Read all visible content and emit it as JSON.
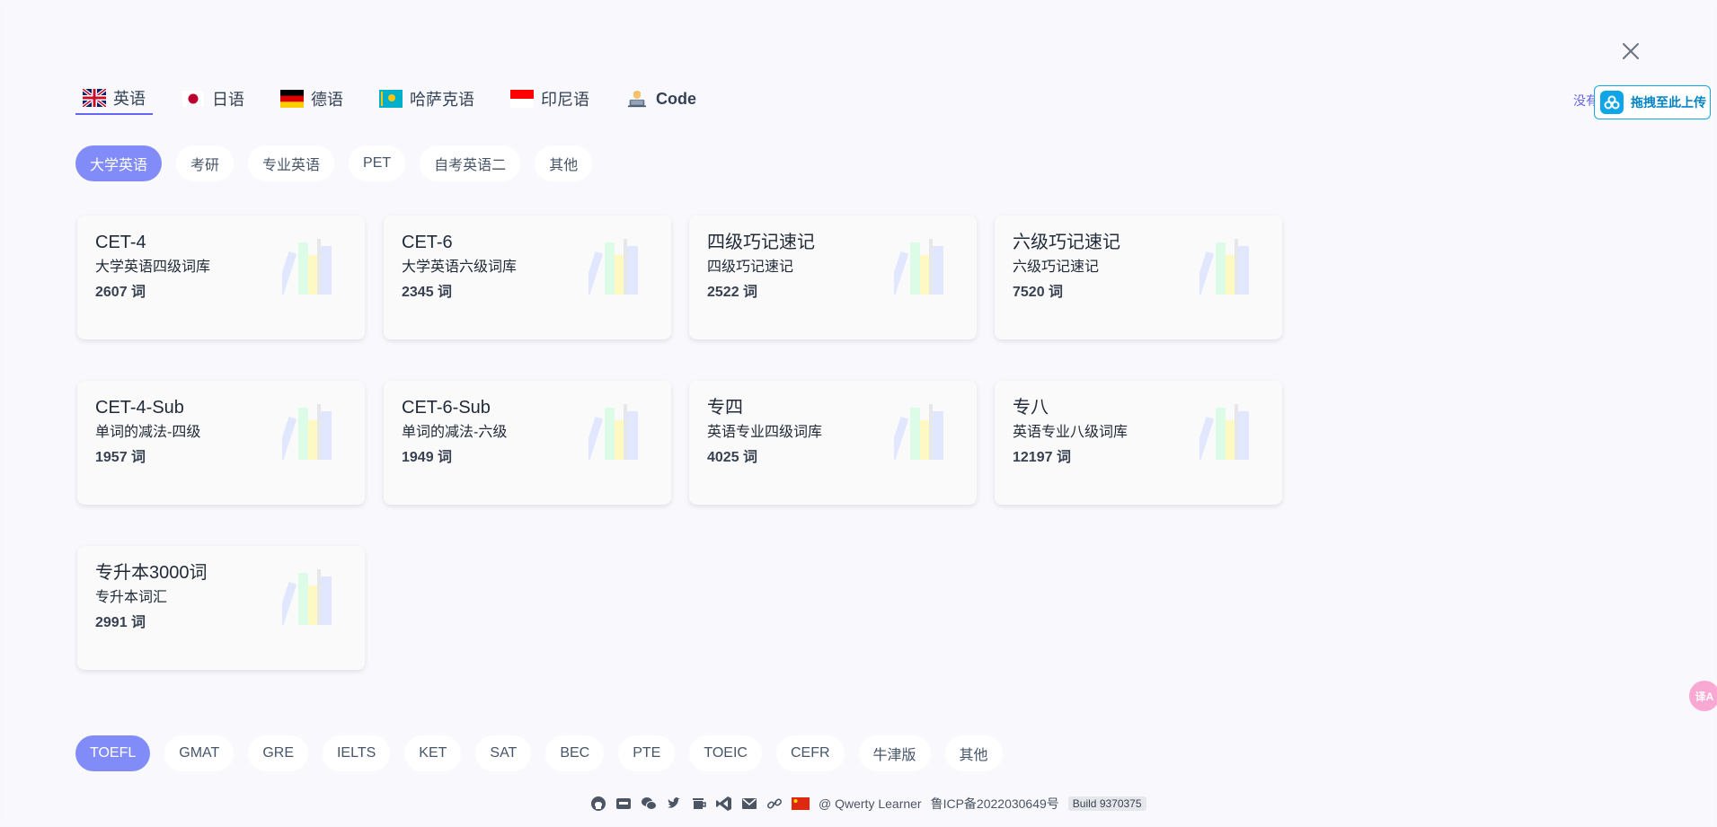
{
  "lang_tabs": [
    {
      "flag": "flag-uk-icon",
      "label": "英语",
      "active": true
    },
    {
      "flag": "flag-jp-icon",
      "label": "日语",
      "active": false
    },
    {
      "flag": "flag-de-icon",
      "label": "德语",
      "active": false
    },
    {
      "flag": "flag-kz-icon",
      "label": "哈萨克语",
      "active": false
    },
    {
      "flag": "flag-id-icon",
      "label": "印尼语",
      "active": false
    },
    {
      "flag": "technologist-icon",
      "label": "Code",
      "active": false
    }
  ],
  "upload": {
    "hint": "没有",
    "label": "拖拽至此上传"
  },
  "categories": {
    "items": [
      "大学英语",
      "考研",
      "专业英语",
      "PET",
      "自考英语二",
      "其他"
    ],
    "active": "大学英语"
  },
  "dictionaries": [
    {
      "title": "CET-4",
      "desc": "大学英语四级词库",
      "count": "2607 词"
    },
    {
      "title": "CET-6",
      "desc": "大学英语六级词库",
      "count": "2345 词"
    },
    {
      "title": "四级巧记速记",
      "desc": "四级巧记速记",
      "count": "2522 词"
    },
    {
      "title": "六级巧记速记",
      "desc": "六级巧记速记",
      "count": "7520 词"
    },
    {
      "title": "CET-4-Sub",
      "desc": "单词的减法-四级",
      "count": "1957 词"
    },
    {
      "title": "CET-6-Sub",
      "desc": "单词的减法-六级",
      "count": "1949 词"
    },
    {
      "title": "专四",
      "desc": "英语专业四级词库",
      "count": "4025 词"
    },
    {
      "title": "专八",
      "desc": "英语专业八级词库",
      "count": "12197 词"
    },
    {
      "title": "专升本3000词",
      "desc": "专升本词汇",
      "count": "2991 词"
    }
  ],
  "exams": {
    "items": [
      "TOEFL",
      "GMAT",
      "GRE",
      "IELTS",
      "KET",
      "SAT",
      "BEC",
      "PTE",
      "TOEIC",
      "CEFR",
      "牛津版",
      "其他"
    ],
    "active": "TOEFL"
  },
  "footer": {
    "icons": [
      "github-icon",
      "blog-icon",
      "wechat-icon",
      "twitter-icon",
      "coffee-icon",
      "vscode-icon",
      "email-icon",
      "link-icon",
      "china-flag-icon"
    ],
    "copyright": "@ Qwerty Learner",
    "icp": "鲁ICP备2022030649号",
    "build": "Build 9370375"
  },
  "translate": {
    "label": "译A"
  },
  "colors": {
    "accent": "#818cf8",
    "underline": "#6366f1",
    "upload": "#0ea5e9"
  }
}
